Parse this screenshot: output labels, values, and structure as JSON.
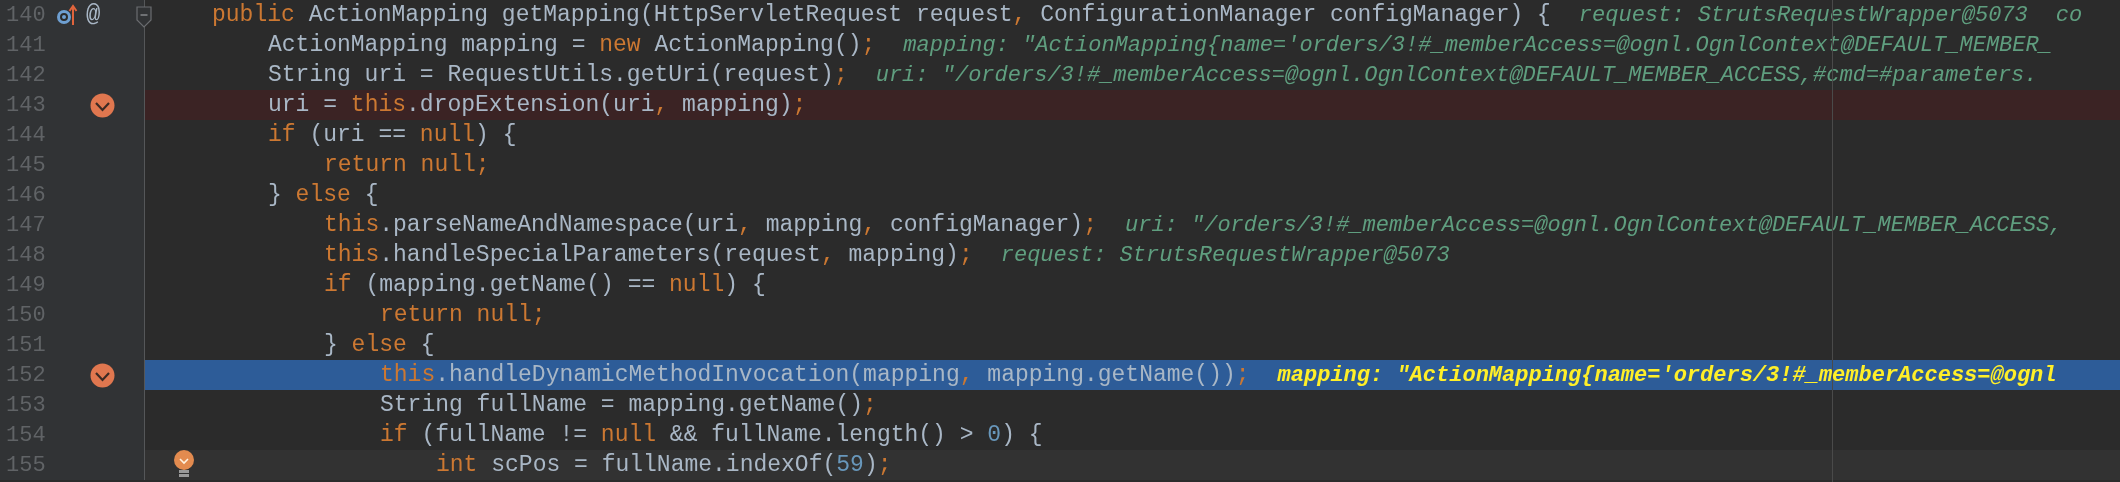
{
  "editor": {
    "lines": [
      {
        "number": "140",
        "breakpoint": false,
        "execution": false,
        "caret": false,
        "bulb": false,
        "fold": true,
        "gutter": [
          {
            "kind": "override"
          },
          {
            "kind": "annotation",
            "text": "@"
          }
        ],
        "segments": [
          {
            "kind": "keyword",
            "text": "public"
          },
          {
            "kind": "plain",
            "text": " ActionMapping getMapping(HttpServletRequest request"
          },
          {
            "kind": "keyword",
            "text": ","
          },
          {
            "kind": "plain",
            "text": " ConfigurationManager configManager) {"
          }
        ],
        "hints": [
          "request: StrutsRequestWrapper@5073",
          "co"
        ],
        "children": [
          {
            "number": "141",
            "breakpoint": false,
            "execution": false,
            "caret": false,
            "bulb": false,
            "fold": false,
            "segments": [
              {
                "kind": "plain",
                "text": "ActionMapping mapping = "
              },
              {
                "kind": "keyword",
                "text": "new"
              },
              {
                "kind": "plain",
                "text": " ActionMapping()"
              },
              {
                "kind": "keyword",
                "text": ";"
              }
            ],
            "hints": [
              "mapping: \"ActionMapping{name='orders/3!#_memberAccess=@ognl.OgnlContext@DEFAULT_MEMBER_"
            ]
          },
          {
            "number": "142",
            "breakpoint": false,
            "execution": false,
            "caret": false,
            "bulb": false,
            "fold": false,
            "segments": [
              {
                "kind": "plain",
                "text": "String uri = RequestUtils.getUri(request)"
              },
              {
                "kind": "keyword",
                "text": ";"
              }
            ],
            "hints": [
              "uri: \"/orders/3!#_memberAccess=@ognl.OgnlContext@DEFAULT_MEMBER_ACCESS,#cmd=#parameters."
            ]
          },
          {
            "number": "143",
            "breakpoint": true,
            "execution": false,
            "caret": false,
            "bulb": false,
            "fold": false,
            "segments": [
              {
                "kind": "plain",
                "text": "uri = "
              },
              {
                "kind": "keyword",
                "text": "this"
              },
              {
                "kind": "plain",
                "text": ".dropExtension(uri"
              },
              {
                "kind": "keyword",
                "text": ","
              },
              {
                "kind": "plain",
                "text": " mapping)"
              },
              {
                "kind": "keyword",
                "text": ";"
              }
            ]
          },
          {
            "number": "144",
            "breakpoint": false,
            "execution": false,
            "caret": false,
            "bulb": false,
            "fold": false,
            "segments": [
              {
                "kind": "keyword",
                "text": "if"
              },
              {
                "kind": "plain",
                "text": " (uri == "
              },
              {
                "kind": "keyword",
                "text": "null"
              },
              {
                "kind": "plain",
                "text": ") {"
              }
            ],
            "children": [
              {
                "number": "145",
                "breakpoint": false,
                "execution": false,
                "caret": false,
                "bulb": false,
                "fold": false,
                "segments": [
                  {
                    "kind": "keyword",
                    "text": "return null;"
                  }
                ]
              }
            ]
          },
          {
            "number": "146",
            "breakpoint": false,
            "execution": false,
            "caret": false,
            "bulb": false,
            "fold": false,
            "segments": [
              {
                "kind": "plain",
                "text": "} "
              },
              {
                "kind": "keyword",
                "text": "else"
              },
              {
                "kind": "plain",
                "text": " {"
              }
            ],
            "children": [
              {
                "number": "147",
                "breakpoint": false,
                "execution": false,
                "caret": false,
                "bulb": false,
                "fold": false,
                "segments": [
                  {
                    "kind": "keyword",
                    "text": "this"
                  },
                  {
                    "kind": "plain",
                    "text": ".parseNameAndNamespace(uri"
                  },
                  {
                    "kind": "keyword",
                    "text": ","
                  },
                  {
                    "kind": "plain",
                    "text": " mapping"
                  },
                  {
                    "kind": "keyword",
                    "text": ","
                  },
                  {
                    "kind": "plain",
                    "text": " configManager)"
                  },
                  {
                    "kind": "keyword",
                    "text": ";"
                  }
                ],
                "hints": [
                  "uri: \"/orders/3!#_memberAccess=@ognl.OgnlContext@DEFAULT_MEMBER_ACCESS,"
                ]
              },
              {
                "number": "148",
                "breakpoint": false,
                "execution": false,
                "caret": false,
                "bulb": false,
                "fold": false,
                "segments": [
                  {
                    "kind": "keyword",
                    "text": "this"
                  },
                  {
                    "kind": "plain",
                    "text": ".handleSpecialParameters(request"
                  },
                  {
                    "kind": "keyword",
                    "text": ","
                  },
                  {
                    "kind": "plain",
                    "text": " mapping)"
                  },
                  {
                    "kind": "keyword",
                    "text": ";"
                  }
                ],
                "hints": [
                  "request: StrutsRequestWrapper@5073"
                ]
              },
              {
                "number": "149",
                "breakpoint": false,
                "execution": false,
                "caret": false,
                "bulb": false,
                "fold": false,
                "segments": [
                  {
                    "kind": "keyword",
                    "text": "if"
                  },
                  {
                    "kind": "plain",
                    "text": " (mapping.getName() == "
                  },
                  {
                    "kind": "keyword",
                    "text": "null"
                  },
                  {
                    "kind": "plain",
                    "text": ") {"
                  }
                ],
                "children": [
                  {
                    "number": "150",
                    "breakpoint": false,
                    "execution": false,
                    "caret": false,
                    "bulb": false,
                    "fold": false,
                    "segments": [
                      {
                        "kind": "keyword",
                        "text": "return null;"
                      }
                    ]
                  }
                ]
              },
              {
                "number": "151",
                "breakpoint": false,
                "execution": false,
                "caret": false,
                "bulb": false,
                "fold": false,
                "segments": [
                  {
                    "kind": "plain",
                    "text": "} "
                  },
                  {
                    "kind": "keyword",
                    "text": "else"
                  },
                  {
                    "kind": "plain",
                    "text": " {"
                  }
                ],
                "children": [
                  {
                    "number": "152",
                    "breakpoint": true,
                    "execution": true,
                    "caret": false,
                    "bulb": false,
                    "fold": false,
                    "segments": [
                      {
                        "kind": "keyword",
                        "text": "this"
                      },
                      {
                        "kind": "plain",
                        "text": ".handleDynamicMethodInvocation(mapping"
                      },
                      {
                        "kind": "keyword",
                        "text": ","
                      },
                      {
                        "kind": "plain",
                        "text": " mapping.getName())"
                      },
                      {
                        "kind": "keyword",
                        "text": ";"
                      }
                    ],
                    "hints": [
                      "mapping: \"ActionMapping{name='orders/3!#_memberAccess=@ognl"
                    ]
                  },
                  {
                    "number": "153",
                    "breakpoint": false,
                    "execution": false,
                    "caret": false,
                    "bulb": false,
                    "fold": false,
                    "segments": [
                      {
                        "kind": "plain",
                        "text": "String fullName = mapping.getName()"
                      },
                      {
                        "kind": "keyword",
                        "text": ";"
                      }
                    ]
                  },
                  {
                    "number": "154",
                    "breakpoint": false,
                    "execution": false,
                    "caret": false,
                    "bulb": false,
                    "fold": false,
                    "segments": [
                      {
                        "kind": "keyword",
                        "text": "if"
                      },
                      {
                        "kind": "plain",
                        "text": " (fullName != "
                      },
                      {
                        "kind": "keyword",
                        "text": "null"
                      },
                      {
                        "kind": "plain",
                        "text": " && fullName.length() > "
                      },
                      {
                        "kind": "number",
                        "text": "0"
                      },
                      {
                        "kind": "plain",
                        "text": ") {"
                      }
                    ],
                    "children": [
                      {
                        "number": "155",
                        "breakpoint": false,
                        "execution": false,
                        "caret": true,
                        "bulb": true,
                        "fold": false,
                        "segments": [
                          {
                            "kind": "keyword",
                            "text": "int"
                          },
                          {
                            "kind": "plain",
                            "text": " scPos = fullName.indexOf("
                          },
                          {
                            "kind": "number",
                            "text": "59"
                          },
                          {
                            "kind": "plain",
                            "text": ")"
                          },
                          {
                            "kind": "keyword",
                            "text": ";"
                          }
                        ]
                      }
                    ]
                  }
                ]
              }
            ]
          }
        ]
      }
    ]
  }
}
